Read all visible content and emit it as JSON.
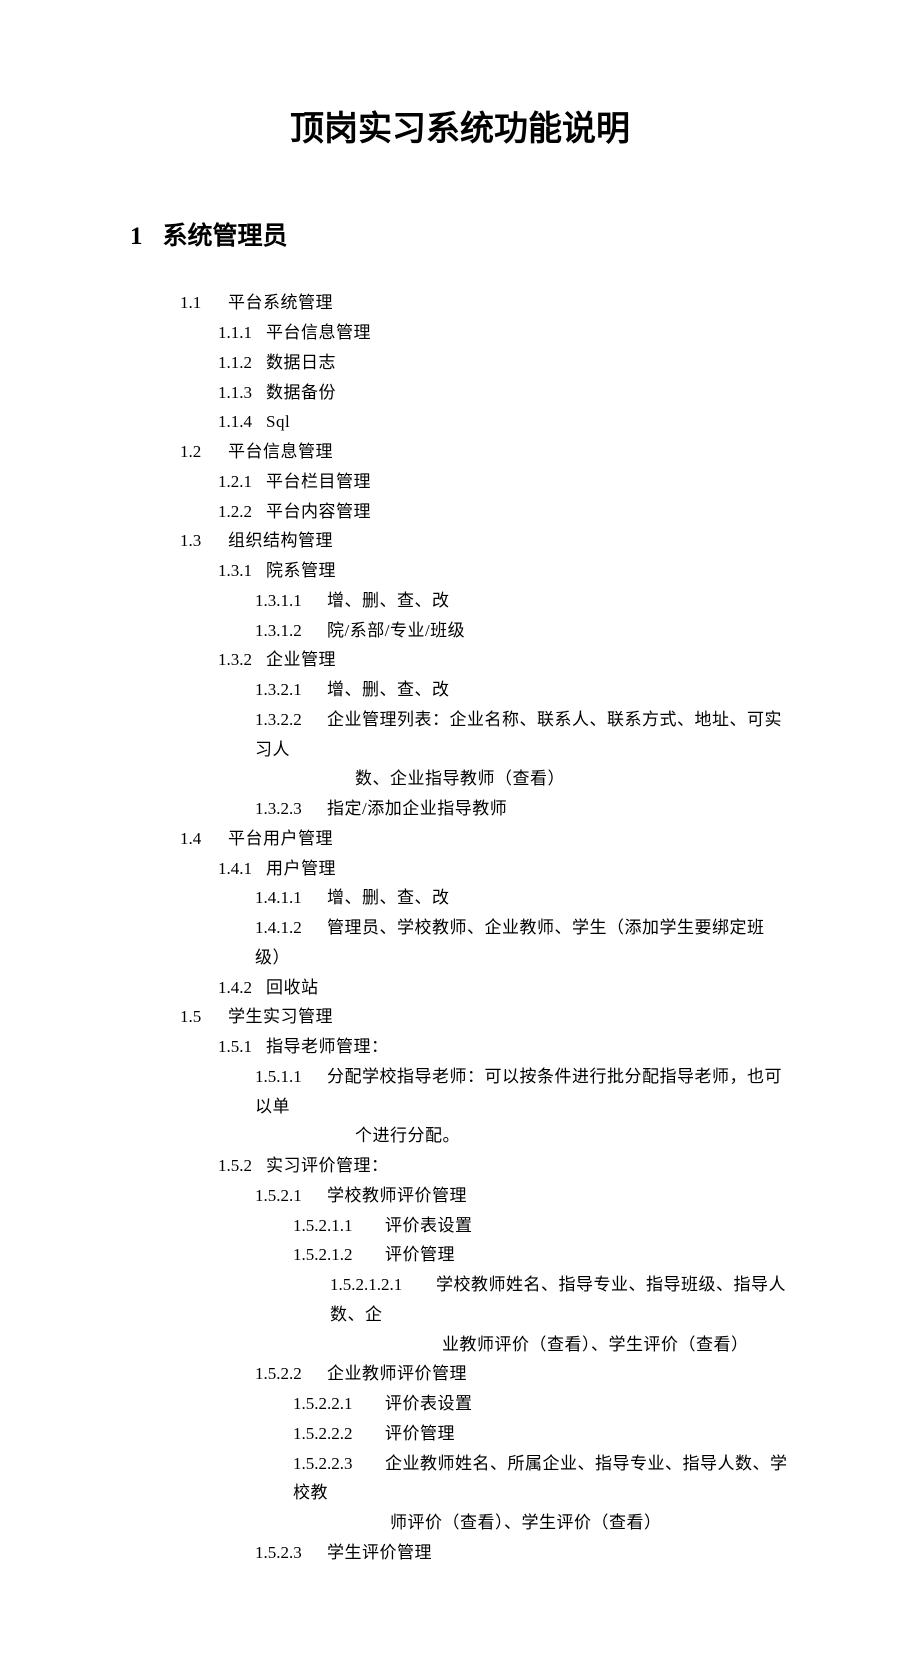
{
  "title": "顶岗实习系统功能说明",
  "section1": {
    "number": "1",
    "title": "系统管理员"
  },
  "s1_1": {
    "num": "1.1",
    "text": "平台系统管理"
  },
  "s1_1_1": {
    "num": "1.1.1",
    "text": "平台信息管理"
  },
  "s1_1_2": {
    "num": "1.1.2",
    "text": "数据日志"
  },
  "s1_1_3": {
    "num": "1.1.3",
    "text": "数据备份"
  },
  "s1_1_4": {
    "num": "1.1.4",
    "text": "Sql"
  },
  "s1_2": {
    "num": "1.2",
    "text": "平台信息管理"
  },
  "s1_2_1": {
    "num": "1.2.1",
    "text": "平台栏目管理"
  },
  "s1_2_2": {
    "num": "1.2.2",
    "text": "平台内容管理"
  },
  "s1_3": {
    "num": "1.3",
    "text": "组织结构管理"
  },
  "s1_3_1": {
    "num": "1.3.1",
    "text": "院系管理"
  },
  "s1_3_1_1": {
    "num": "1.3.1.1",
    "text": "增、删、查、改"
  },
  "s1_3_1_2": {
    "num": "1.3.1.2",
    "text": "院/系部/专业/班级"
  },
  "s1_3_2": {
    "num": "1.3.2",
    "text": "企业管理"
  },
  "s1_3_2_1": {
    "num": "1.3.2.1",
    "text": "增、删、查、改"
  },
  "s1_3_2_2": {
    "num": "1.3.2.2",
    "text": "企业管理列表：企业名称、联系人、联系方式、地址、可实习人",
    "cont": "数、企业指导教师（查看）"
  },
  "s1_3_2_3": {
    "num": "1.3.2.3",
    "text": "指定/添加企业指导教师"
  },
  "s1_4": {
    "num": "1.4",
    "text": "平台用户管理"
  },
  "s1_4_1": {
    "num": "1.4.1",
    "text": "用户管理"
  },
  "s1_4_1_1": {
    "num": "1.4.1.1",
    "text": "增、删、查、改"
  },
  "s1_4_1_2": {
    "num": "1.4.1.2",
    "text": "管理员、学校教师、企业教师、学生（添加学生要绑定班级）"
  },
  "s1_4_2": {
    "num": "1.4.2",
    "text": "回收站"
  },
  "s1_5": {
    "num": "1.5",
    "text": "学生实习管理"
  },
  "s1_5_1": {
    "num": "1.5.1",
    "text": "指导老师管理："
  },
  "s1_5_1_1": {
    "num": "1.5.1.1",
    "text": "分配学校指导老师：可以按条件进行批分配指导老师，也可以单",
    "cont": "个进行分配。"
  },
  "s1_5_2": {
    "num": "1.5.2",
    "text": "实习评价管理："
  },
  "s1_5_2_1": {
    "num": "1.5.2.1",
    "text": "学校教师评价管理"
  },
  "s1_5_2_1_1": {
    "num": "1.5.2.1.1",
    "text": "评价表设置"
  },
  "s1_5_2_1_2": {
    "num": "1.5.2.1.2",
    "text": "评价管理"
  },
  "s1_5_2_1_2_1": {
    "num": "1.5.2.1.2.1",
    "text": "学校教师姓名、指导专业、指导班级、指导人数、企",
    "cont": "业教师评价（查看）、学生评价（查看）"
  },
  "s1_5_2_2": {
    "num": "1.5.2.2",
    "text": "企业教师评价管理"
  },
  "s1_5_2_2_1": {
    "num": "1.5.2.2.1",
    "text": "评价表设置"
  },
  "s1_5_2_2_2": {
    "num": "1.5.2.2.2",
    "text": "评价管理"
  },
  "s1_5_2_2_3": {
    "num": "1.5.2.2.3",
    "text": "企业教师姓名、所属企业、指导专业、指导人数、学校教",
    "cont": "师评价（查看）、学生评价（查看）"
  },
  "s1_5_2_3": {
    "num": "1.5.2.3",
    "text": "学生评价管理"
  }
}
